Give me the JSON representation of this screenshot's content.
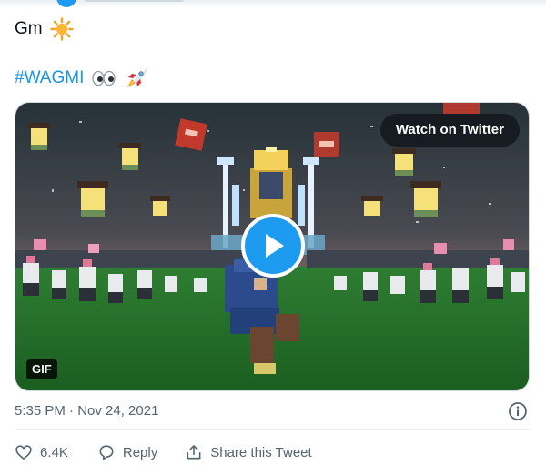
{
  "tweet": {
    "line1_text": "Gm",
    "line1_icon": "sun-emoji-icon",
    "hashtag": "#WAGMI",
    "line2_icons": [
      "eyes-emoji-icon",
      "rocket-emoji-icon"
    ]
  },
  "media": {
    "watch_label": "Watch on Twitter",
    "gif_label": "GIF",
    "play_icon": "play-icon"
  },
  "meta": {
    "timestamp": "5:35 PM · Nov 24, 2021",
    "info_icon": "info-icon"
  },
  "actions": {
    "likes_count": "6.4K",
    "reply_label": "Reply",
    "share_label": "Share this Tweet"
  },
  "colors": {
    "accent": "#1d9bf0",
    "hashtag": "#1b95e0",
    "secondary_text": "#536471"
  }
}
